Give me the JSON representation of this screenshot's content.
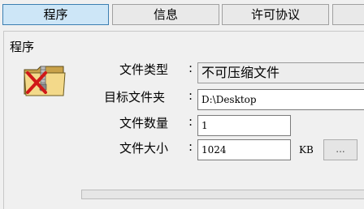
{
  "tabs": [
    {
      "label": "程序"
    },
    {
      "label": "信息"
    },
    {
      "label": "许可协议"
    },
    {
      "label": ""
    }
  ],
  "group": {
    "title": "程序"
  },
  "fields": {
    "file_type": {
      "label": "文件类型",
      "value": "不可压缩文件"
    },
    "target_folder": {
      "label": "目标文件夹",
      "value": "D:\\Desktop"
    },
    "file_count": {
      "label": "文件数量",
      "value": "1"
    },
    "file_size": {
      "label": "文件大小",
      "value": "1024",
      "unit": "KB"
    }
  },
  "colon": ":",
  "browse_button": {
    "label": "..."
  },
  "icon": {
    "name": "compressed-folder-blocked-icon"
  }
}
